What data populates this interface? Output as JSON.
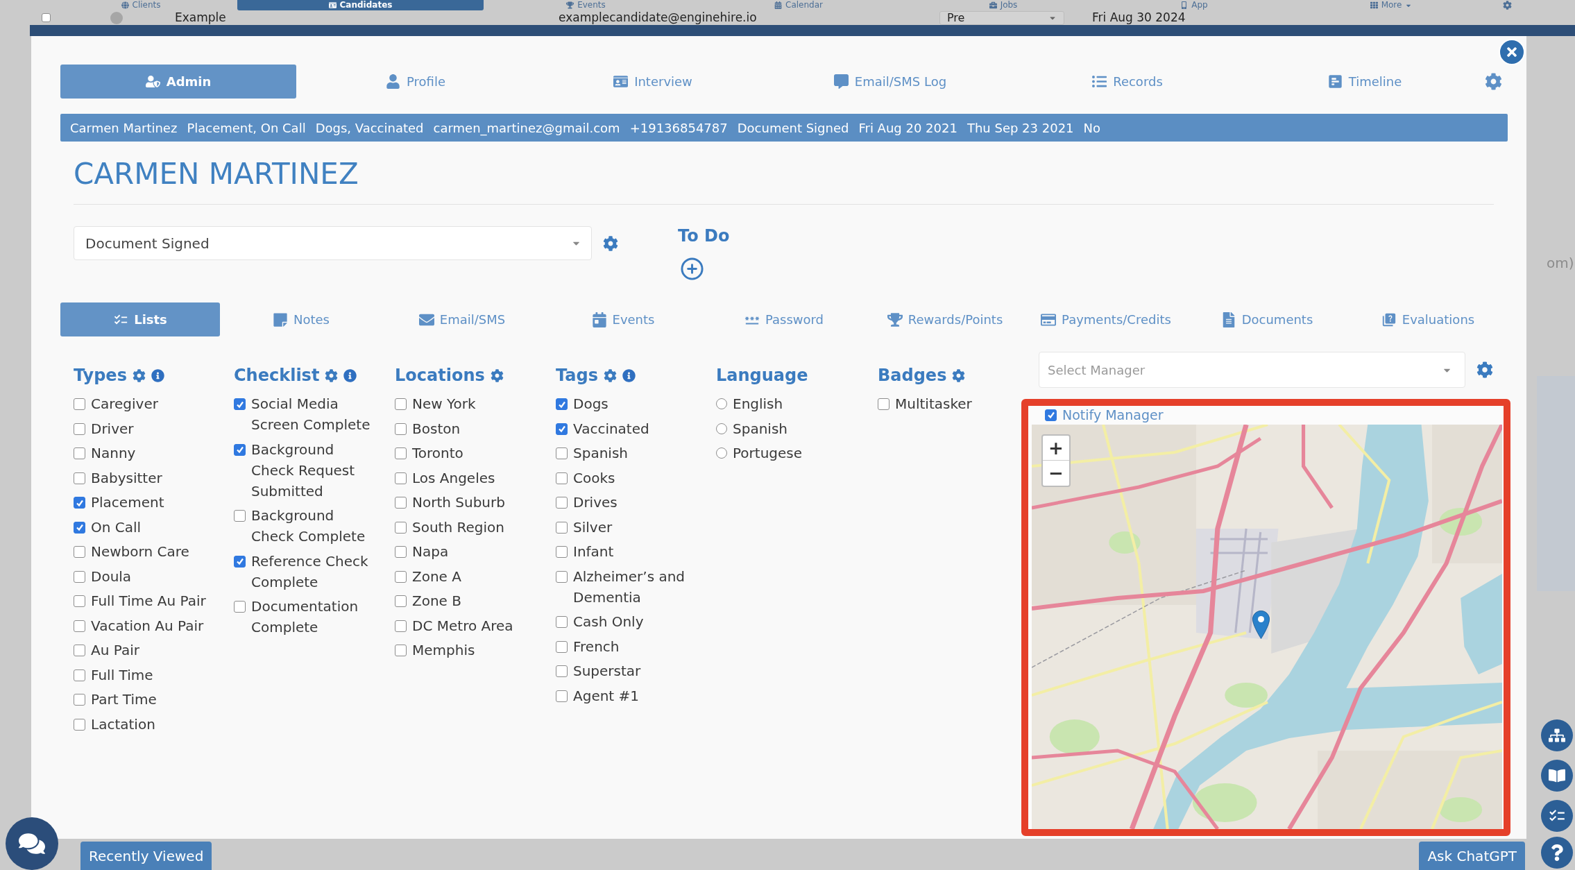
{
  "background_page": {
    "nav": [
      {
        "label": "Clients",
        "selected": false
      },
      {
        "label": "Candidates",
        "selected": true
      },
      {
        "label": "Events",
        "selected": false
      },
      {
        "label": "Calendar",
        "selected": false
      },
      {
        "label": "Jobs",
        "selected": false
      },
      {
        "label": "App",
        "selected": false
      },
      {
        "label": "More",
        "selected": false
      }
    ],
    "row": {
      "checked": false,
      "name": "Example",
      "email": "examplecandidate@enginehire.io",
      "status": "Pre",
      "date": "Fri Aug 30 2024"
    },
    "side_text": "om)"
  },
  "modal": {
    "tabs": [
      {
        "label": "Admin",
        "selected": true
      },
      {
        "label": "Profile",
        "selected": false
      },
      {
        "label": "Interview",
        "selected": false
      },
      {
        "label": "Email/SMS Log",
        "selected": false
      },
      {
        "label": "Records",
        "selected": false
      },
      {
        "label": "Timeline",
        "selected": false
      }
    ],
    "summary": [
      "Carmen Martinez",
      "Placement, On Call",
      "Dogs, Vaccinated",
      "carmen_martinez@gmail.com",
      "+19136854787",
      "Document Signed",
      "Fri Aug 20 2021",
      "Thu Sep 23 2021",
      "No"
    ],
    "name": "CARMEN MARTINEZ",
    "status": {
      "value": "Document Signed"
    },
    "todo": {
      "title": "To Do"
    },
    "section_tabs": [
      {
        "label": "Lists",
        "selected": true
      },
      {
        "label": "Notes",
        "selected": false
      },
      {
        "label": "Email/SMS",
        "selected": false
      },
      {
        "label": "Events",
        "selected": false
      },
      {
        "label": "Password",
        "selected": false
      },
      {
        "label": "Rewards/Points",
        "selected": false
      },
      {
        "label": "Payments/Credits",
        "selected": false
      },
      {
        "label": "Documents",
        "selected": false
      },
      {
        "label": "Evaluations",
        "selected": false
      }
    ],
    "lists": [
      {
        "title": "Types",
        "settings": true,
        "info": true,
        "kind": "checkbox",
        "items": [
          {
            "label": "Caregiver",
            "checked": false
          },
          {
            "label": "Driver",
            "checked": false
          },
          {
            "label": "Nanny",
            "checked": false
          },
          {
            "label": "Babysitter",
            "checked": false
          },
          {
            "label": "Placement",
            "checked": true
          },
          {
            "label": "On Call",
            "checked": true
          },
          {
            "label": "Newborn Care",
            "checked": false
          },
          {
            "label": "Doula",
            "checked": false
          },
          {
            "label": "Full Time Au Pair",
            "checked": false
          },
          {
            "label": "Vacation Au Pair",
            "checked": false
          },
          {
            "label": "Au Pair",
            "checked": false
          },
          {
            "label": "Full Time",
            "checked": false
          },
          {
            "label": "Part Time",
            "checked": false
          },
          {
            "label": "Lactation",
            "checked": false
          }
        ]
      },
      {
        "title": "Checklist",
        "settings": true,
        "info": true,
        "kind": "checkbox",
        "items": [
          {
            "label": "Social Media Screen Complete",
            "checked": true
          },
          {
            "label": "Background Check Request Submitted",
            "checked": true
          },
          {
            "label": "Background Check Complete",
            "checked": false
          },
          {
            "label": "Reference Check Complete",
            "checked": true
          },
          {
            "label": "Documentation Complete",
            "checked": false
          }
        ]
      },
      {
        "title": "Locations",
        "settings": true,
        "info": false,
        "kind": "checkbox",
        "items": [
          {
            "label": "New York",
            "checked": false
          },
          {
            "label": "Boston",
            "checked": false
          },
          {
            "label": "Toronto",
            "checked": false
          },
          {
            "label": "Los Angeles",
            "checked": false
          },
          {
            "label": "North Suburb",
            "checked": false
          },
          {
            "label": "South Region",
            "checked": false
          },
          {
            "label": "Napa",
            "checked": false
          },
          {
            "label": "Zone A",
            "checked": false
          },
          {
            "label": "Zone B",
            "checked": false
          },
          {
            "label": "DC Metro Area",
            "checked": false
          },
          {
            "label": "Memphis",
            "checked": false
          }
        ]
      },
      {
        "title": "Tags",
        "settings": true,
        "info": true,
        "kind": "checkbox",
        "items": [
          {
            "label": "Dogs",
            "checked": true
          },
          {
            "label": "Vaccinated",
            "checked": true
          },
          {
            "label": "Spanish",
            "checked": false
          },
          {
            "label": "Cooks",
            "checked": false
          },
          {
            "label": "Drives",
            "checked": false
          },
          {
            "label": "Silver",
            "checked": false
          },
          {
            "label": "Infant",
            "checked": false
          },
          {
            "label": "Alzheimer’s and Dementia",
            "checked": false
          },
          {
            "label": "Cash Only",
            "checked": false
          },
          {
            "label": "French",
            "checked": false
          },
          {
            "label": "Superstar",
            "checked": false
          },
          {
            "label": "Agent #1",
            "checked": false
          }
        ]
      },
      {
        "title": "Language",
        "settings": false,
        "info": false,
        "kind": "radio",
        "items": [
          {
            "label": "English",
            "selected": false
          },
          {
            "label": "Spanish",
            "selected": false
          },
          {
            "label": "Portugese",
            "selected": false
          }
        ]
      },
      {
        "title": "Badges",
        "settings": true,
        "info": false,
        "kind": "checkbox",
        "items": [
          {
            "label": "Multitasker",
            "checked": false
          }
        ]
      }
    ],
    "manager": {
      "placeholder": "Select Manager",
      "notify": {
        "label": "Notify Manager",
        "checked": true
      }
    },
    "map": {
      "zoom_in": "+",
      "zoom_out": "−"
    }
  },
  "footer": {
    "recently_viewed": "Recently Viewed",
    "ask": "Ask ChatGPT"
  }
}
